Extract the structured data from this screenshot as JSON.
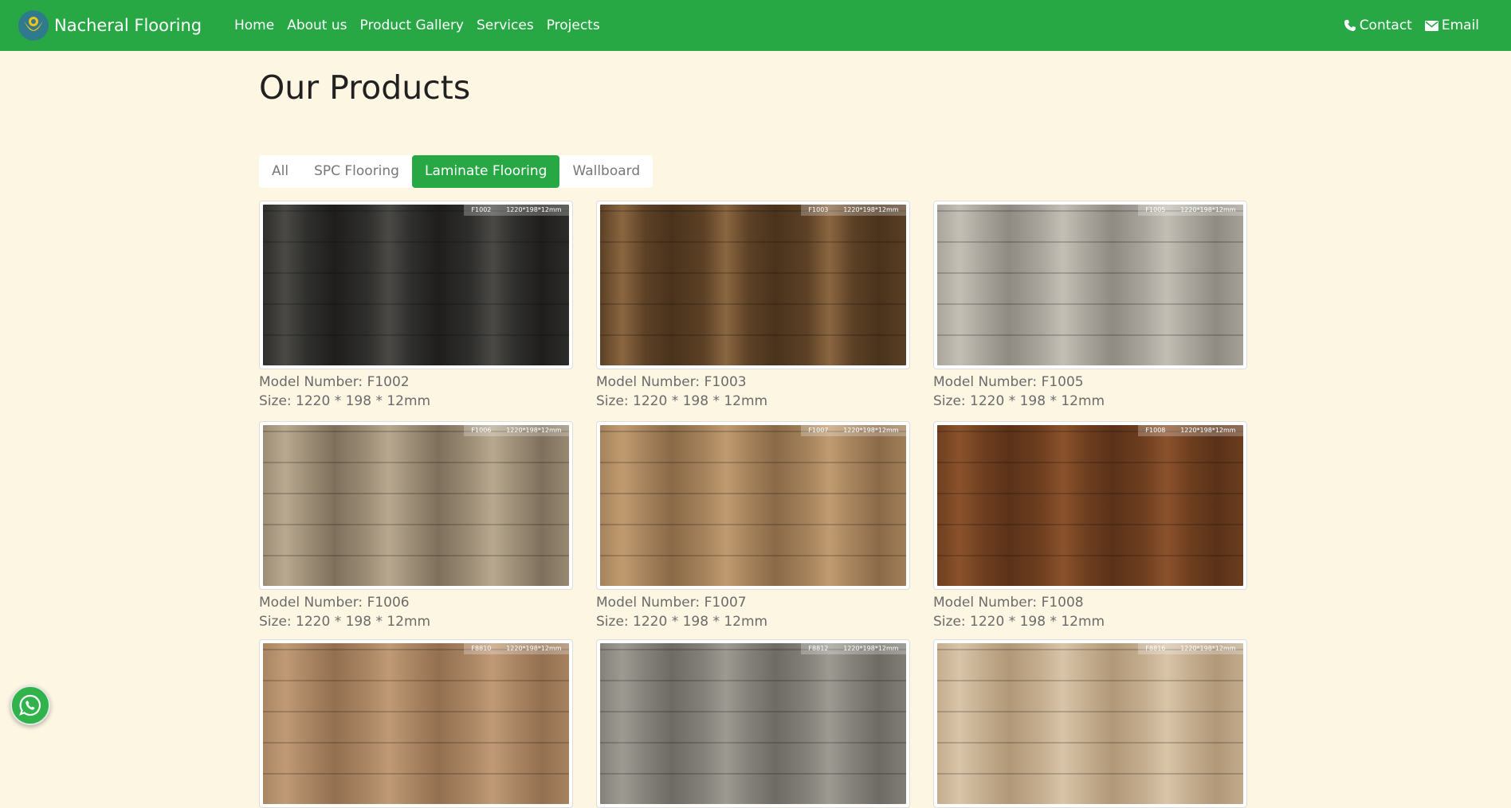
{
  "brand": {
    "name": "Nacheral Flooring",
    "primary_color": "#28a745",
    "background": "#fdf6e3"
  },
  "nav": {
    "links": [
      "Home",
      "About us",
      "Product Gallery",
      "Services",
      "Projects"
    ],
    "contact_label": "Contact",
    "email_label": "Email"
  },
  "page": {
    "title": "Our Products"
  },
  "filters": {
    "items": [
      "All",
      "SPC Flooring",
      "Laminate Flooring",
      "Wallboard"
    ],
    "active": "Laminate Flooring"
  },
  "products": [
    {
      "model": "Model Number: F1002",
      "size": "Size: 1220 * 198 * 12mm",
      "tag": "F1002",
      "tag_size": "1220*198*12mm",
      "swatch": [
        "#2e2e2c",
        "#4a4946",
        "#1f1e1c"
      ]
    },
    {
      "model": "Model Number: F1003",
      "size": "Size: 1220 * 198 * 12mm",
      "tag": "F1003",
      "tag_size": "1220*198*12mm",
      "swatch": [
        "#5c4126",
        "#8a6640",
        "#4a321c"
      ]
    },
    {
      "model": "Model Number: F1005",
      "size": "Size: 1220 * 198 * 12mm",
      "tag": "F1005",
      "tag_size": "1220*198*12mm",
      "swatch": [
        "#a9a59c",
        "#c3bfb5",
        "#8f8b82"
      ]
    },
    {
      "model": "Model Number: F1006",
      "size": "Size: 1220 * 198 * 12mm",
      "tag": "F1006",
      "tag_size": "1220*198*12mm",
      "swatch": [
        "#9c8d76",
        "#b8a890",
        "#7e705c"
      ]
    },
    {
      "model": "Model Number: F1007",
      "size": "Size: 1220 * 198 * 12mm",
      "tag": "F1007",
      "tag_size": "1220*198*12mm",
      "swatch": [
        "#a4825c",
        "#c19b70",
        "#8a6a48"
      ]
    },
    {
      "model": "Model Number: F1008",
      "size": "Size: 1220 * 198 * 12mm",
      "tag": "F1008",
      "tag_size": "1220*198*12mm",
      "swatch": [
        "#6e3f20",
        "#8a522c",
        "#5a3219"
      ]
    },
    {
      "model": "",
      "size": "",
      "tag": "F8810",
      "tag_size": "1220*198*12mm",
      "swatch": [
        "#a98563",
        "#c09a76",
        "#937050"
      ]
    },
    {
      "model": "",
      "size": "",
      "tag": "F8812",
      "tag_size": "1220*198*12mm",
      "swatch": [
        "#84817a",
        "#9d9a92",
        "#6e6b64"
      ]
    },
    {
      "model": "",
      "size": "",
      "tag": "F8816",
      "tag_size": "1220*198*12mm",
      "swatch": [
        "#c5ae90",
        "#d8c4a8",
        "#b09878"
      ]
    }
  ],
  "icons": {
    "contact": "phone-icon",
    "email": "envelope-icon",
    "floating": "whatsapp-icon",
    "logo": "logo-icon"
  }
}
